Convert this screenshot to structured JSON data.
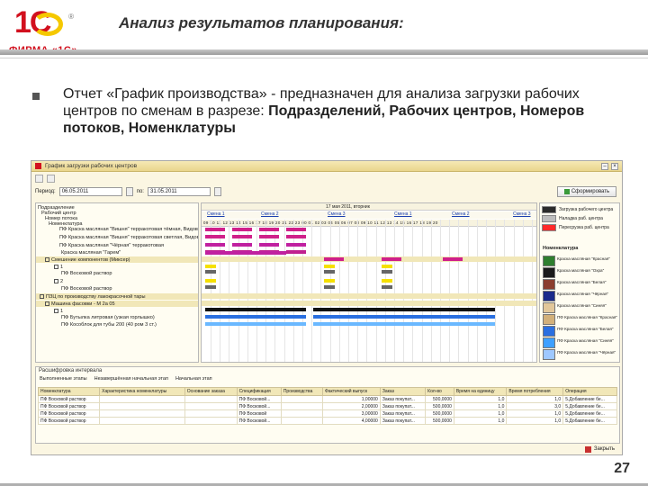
{
  "slide": {
    "logo_text": "1С",
    "logo_firm": "ФИРМА «1С»",
    "title": "Анализ результатов планирования:",
    "bullet_part1": "Отчет «График производства» - предназначен для анализа загрузки рабочих центров по сменам в разрезе: ",
    "bullet_bold": "Подразделений, Рабочих центров, Номеров потоков, Номенклатуры",
    "page_number": "27"
  },
  "window": {
    "title": "График загрузки рабочих центров",
    "period_label": "Период:",
    "date_from": "06.05.2011",
    "to_label": "по:",
    "date_to": "31.05.2011",
    "form_button": "Сформировать",
    "gantt_header": "17 мая 2011, вторник",
    "shifts": [
      "Смена 1",
      "Смена 2",
      "Смена 3",
      "Смена 1",
      "Смена 2",
      "Смена 3"
    ],
    "hours": "09 10 11 12 13 14 15 16 17 18 19 20 21 22 23 00 01 02 03 04 05 06 07 08 09 10 11 12 13 14 15 16 17 18 19 20",
    "tree": [
      "Подразделение",
      "Рабочий центр",
      "Номер потока",
      "Номенклатура",
      "ПФ Краска масляная \"Вишня\" терракотовая тёмная, Видов.",
      "ПФ Краска масляная \"Вишня\" терракотовая светлая, Видов.",
      "ПФ Краска масляная \"Чёрная\" терракотовая",
      "Краска масляная \"Гарем\"",
      "Смешение компонентов (Миксер)",
      "1",
      "ПФ Восковой раствор",
      "2",
      "ПФ Восковой раствор",
      "ПЗЦ по производству лакокрасочной тары",
      "Машина фасовки - М 2а 05",
      "1",
      "ПФ Бутылка литровая (узкая горлышко)",
      "ПФ Кособлок для тубы 200 (40 ром 3 ст.)"
    ],
    "legend_top": [
      {
        "label": "Загрузка рабочего центра",
        "color": "#2b2b2b"
      },
      {
        "label": "Наладка раб. центра",
        "color": "#bdbdbd"
      },
      {
        "label": "Пересрузка раб. центра",
        "color": "#ff2a2a"
      }
    ],
    "legend_header": "Номенклатура",
    "legend_items": [
      {
        "label": "Краска масляная \"Красная\"",
        "color": "#2f7f2f"
      },
      {
        "label": "Краска масляная \"Охра\"",
        "color": "#1b1b1b"
      },
      {
        "label": "Краска масляная \"Белая\"",
        "color": "#8b3e2e"
      },
      {
        "label": "Краска масляная \"Чёрная\"",
        "color": "#1b2b8b"
      },
      {
        "label": "Краска масляная \"Синяя\"",
        "color": "#e2c79a"
      },
      {
        "label": "ПФ Краска масляная \"Красная\"",
        "color": "#d2b07a"
      },
      {
        "label": "ПФ Краска масляная \"Белая\"",
        "color": "#2a6fe0"
      },
      {
        "label": "ПФ Краска масляная \"Синяя\"",
        "color": "#3ea0ff"
      },
      {
        "label": "ПФ Краска масляная \"Чёрная\"",
        "color": "#9ec8ff"
      }
    ],
    "bottom": {
      "title": "Расшифровка интервала",
      "bar_item1": "Выполненные этапы",
      "bar_item2": "Незавершённая начальная этап",
      "bar_item3": "Начальная этап",
      "headers": [
        "Номенклатура",
        "Характеристика номенклатуры",
        "Основание заказа",
        "Спецификация",
        "Производства",
        "Фактический выпуск",
        "Заказ",
        "Кол-во",
        "Время на единицу",
        "Время потребления",
        "Операция"
      ],
      "rows": [
        [
          "ПФ Восковой раствор",
          "",
          "",
          "ПФ Восковой...",
          "",
          "1,00000",
          "Заказ покупат...",
          "500,0000",
          "1,0",
          "1,0",
          "5.Добавление бе..."
        ],
        [
          "ПФ Восковой раствор",
          "",
          "",
          "ПФ Восковой...",
          "",
          "2,00000",
          "Заказ покупат...",
          "500,0000",
          "1,0",
          "3,0",
          "5.Добавление бе..."
        ],
        [
          "ПФ Восковой раствор",
          "",
          "",
          "ПФ Восковой",
          "",
          "3,00000",
          "Заказ покупат...",
          "500,0000",
          "1,0",
          "1,0",
          "5.Добавление бе..."
        ],
        [
          "ПФ Восковой раствор",
          "",
          "",
          "ПФ Восковой...",
          "",
          "4,00000",
          "Заказ покупат...",
          "500,0000",
          "1,0",
          "1,0",
          "5.Добавление бе..."
        ]
      ]
    },
    "close_label": "Закрыть"
  }
}
